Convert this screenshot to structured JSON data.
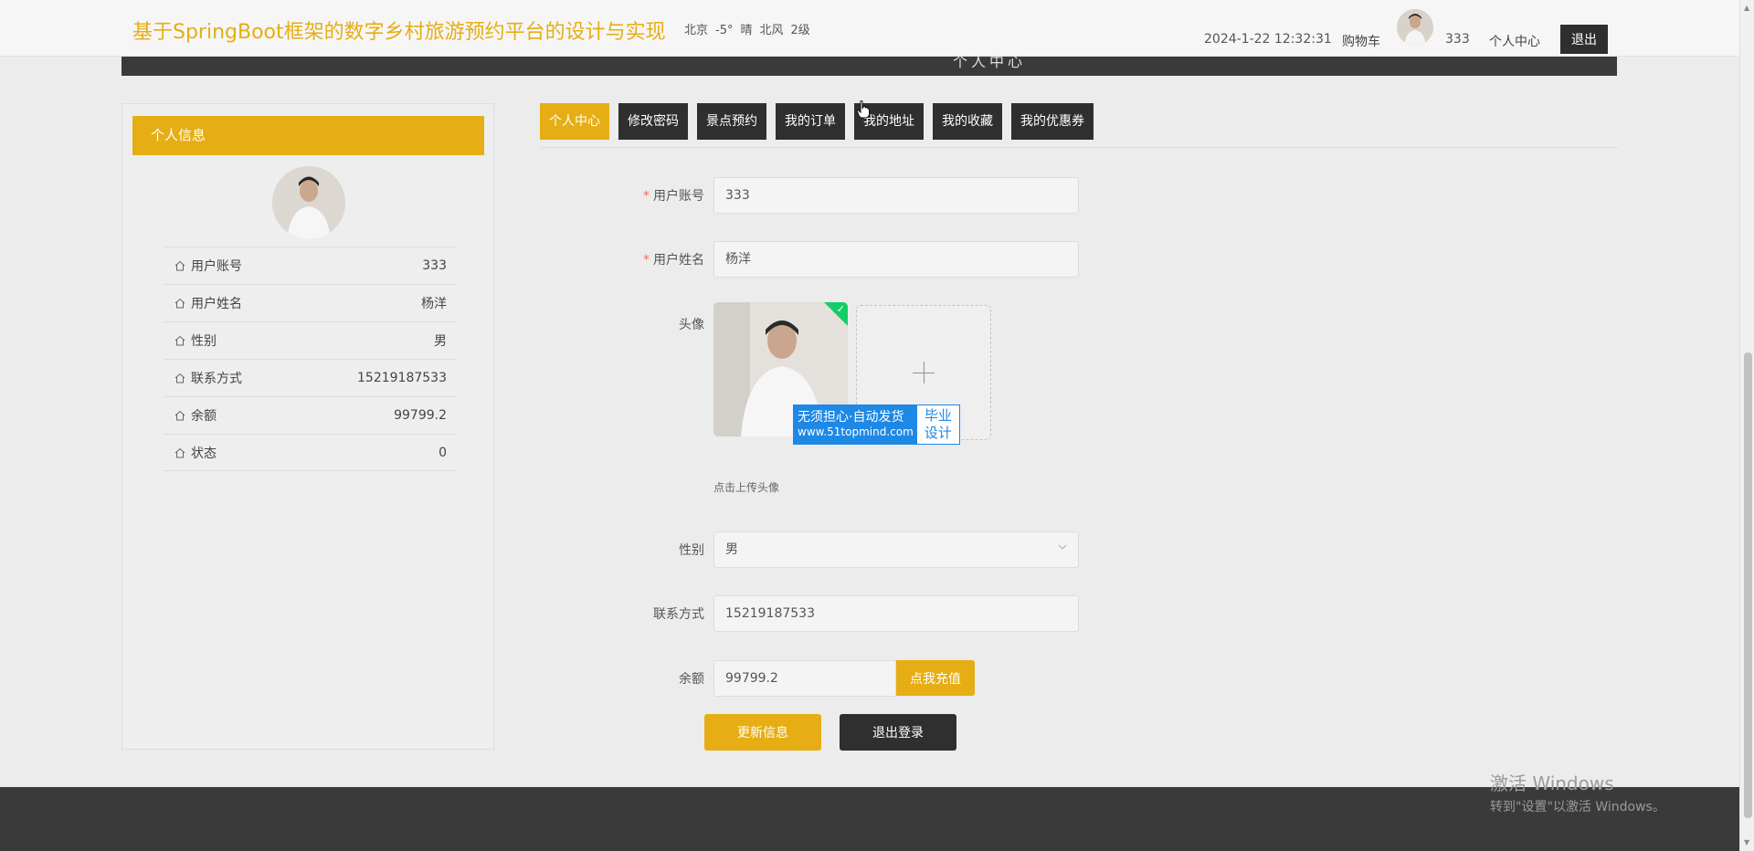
{
  "header": {
    "site_title": "基于SpringBoot框架的数字乡村旅游预约平台的设计与实现",
    "weather": {
      "city": "北京",
      "temp": "-5°",
      "condition": "晴",
      "wind": "北风",
      "level": "2级"
    },
    "datetime": "2024-1-22 12:32:31",
    "cart": "购物车",
    "username": "333",
    "user_center": "个人中心",
    "logout": "退出",
    "band_text": "个人中心"
  },
  "panel": {
    "title": "个人信息",
    "rows": [
      {
        "label": "用户账号",
        "value": "333"
      },
      {
        "label": "用户姓名",
        "value": "杨洋"
      },
      {
        "label": "性别",
        "value": "男"
      },
      {
        "label": "联系方式",
        "value": "15219187533"
      },
      {
        "label": "余额",
        "value": "99799.2"
      },
      {
        "label": "状态",
        "value": "0"
      }
    ]
  },
  "tabs": [
    {
      "label": "个人中心",
      "active": true
    },
    {
      "label": "修改密码"
    },
    {
      "label": "景点预约"
    },
    {
      "label": "我的订单"
    },
    {
      "label": "我的地址"
    },
    {
      "label": "我的收藏"
    },
    {
      "label": "我的优惠券"
    }
  ],
  "form": {
    "account_label": "用户账号",
    "account_value": "333",
    "name_label": "用户姓名",
    "name_value": "杨洋",
    "avatar_label": "头像",
    "upload_hint": "点击上传头像",
    "gender_label": "性别",
    "gender_value": "男",
    "phone_label": "联系方式",
    "phone_value": "15219187533",
    "balance_label": "余额",
    "balance_value": "99799.2",
    "recharge_button": "点我充值",
    "update_button": "更新信息",
    "logout_button": "退出登录"
  },
  "watermark": {
    "line1": "无须担心·自动发货",
    "line2": "www.51topmind.com",
    "side_line1": "毕业",
    "side_line2": "设计"
  },
  "os_overlay": {
    "title": "激活 Windows",
    "subtitle": "转到\"设置\"以激活 Windows。"
  },
  "colors": {
    "accent": "#e6ae14",
    "dark": "#2f2f2f",
    "footer": "#3a3a3a",
    "success": "#13ce66"
  }
}
